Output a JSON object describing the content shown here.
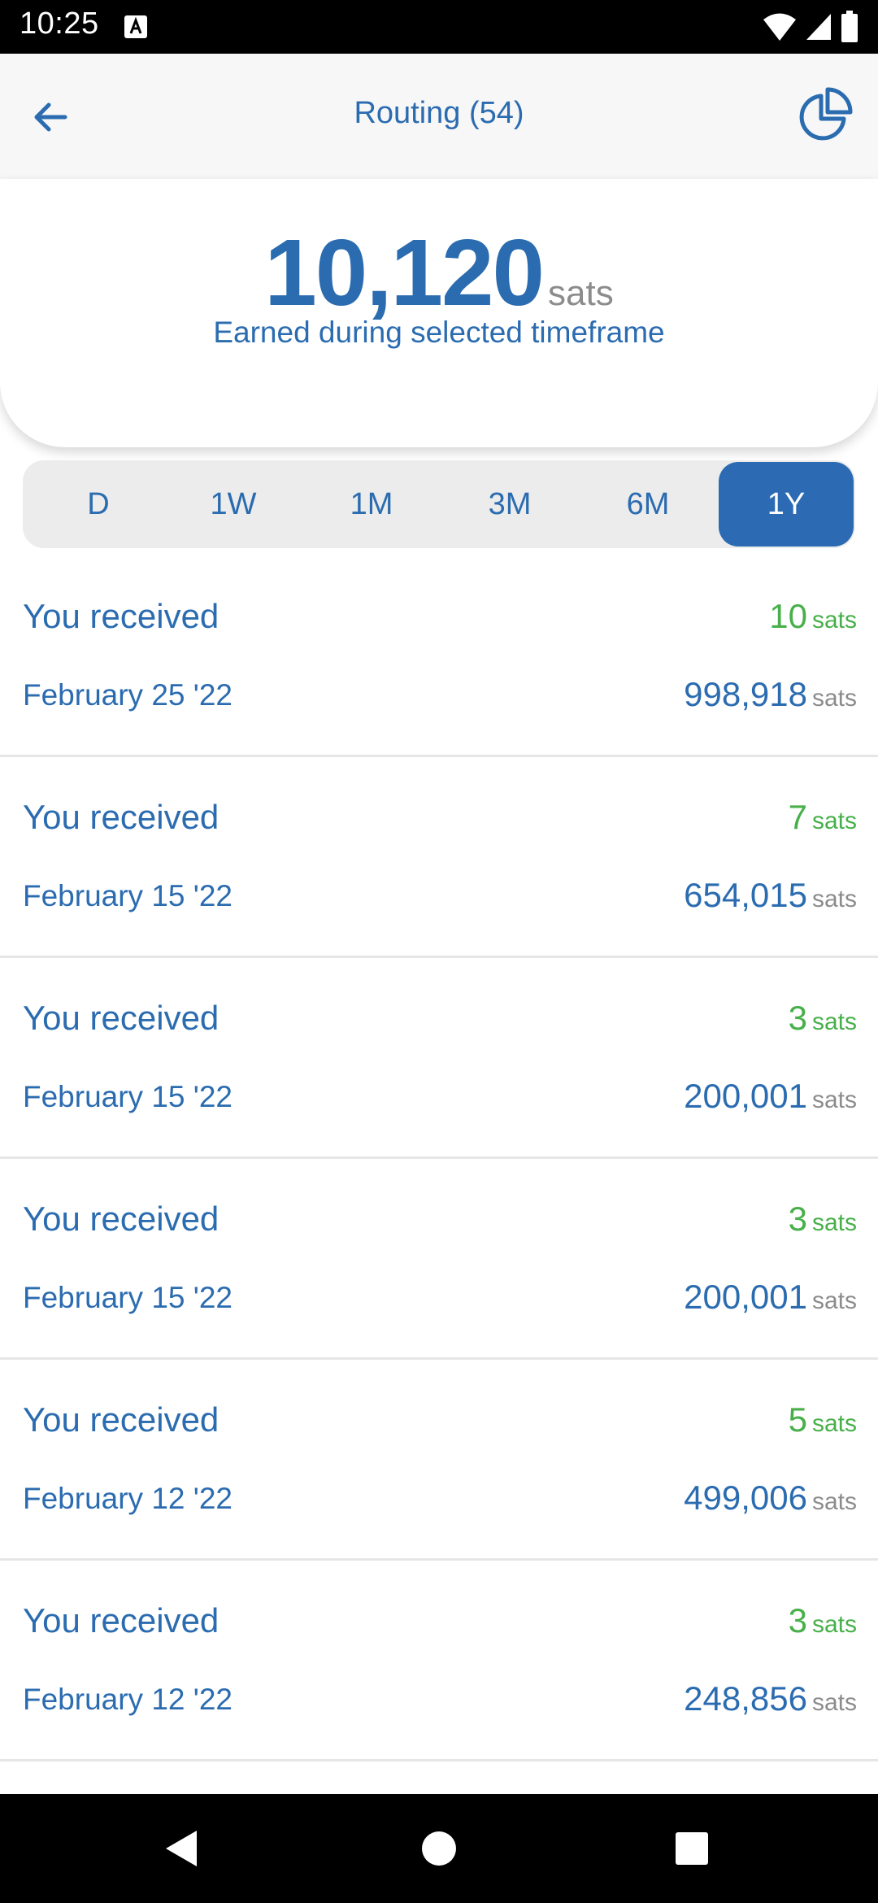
{
  "status_bar": {
    "time": "10:25",
    "icons": [
      "a-notification-icon",
      "wifi-icon",
      "cellular-signal-icon",
      "battery-icon"
    ]
  },
  "header": {
    "title": "Routing (54)",
    "back_icon": "arrow-left-icon",
    "chart_icon": "pie-chart-icon"
  },
  "summary": {
    "amount": "10,120",
    "unit": "sats",
    "caption": "Earned during selected timeframe"
  },
  "timeframes": {
    "options": [
      "D",
      "1W",
      "1M",
      "3M",
      "6M",
      "1Y"
    ],
    "selected": "1Y"
  },
  "transactions": [
    {
      "label": "You received",
      "fee": "10",
      "fee_unit": "sats",
      "date": "February 25 '22",
      "amount": "998,918",
      "amount_unit": "sats"
    },
    {
      "label": "You received",
      "fee": "7",
      "fee_unit": "sats",
      "date": "February 15 '22",
      "amount": "654,015",
      "amount_unit": "sats"
    },
    {
      "label": "You received",
      "fee": "3",
      "fee_unit": "sats",
      "date": "February 15 '22",
      "amount": "200,001",
      "amount_unit": "sats"
    },
    {
      "label": "You received",
      "fee": "3",
      "fee_unit": "sats",
      "date": "February 15 '22",
      "amount": "200,001",
      "amount_unit": "sats"
    },
    {
      "label": "You received",
      "fee": "5",
      "fee_unit": "sats",
      "date": "February 12 '22",
      "amount": "499,006",
      "amount_unit": "sats"
    },
    {
      "label": "You received",
      "fee": "3",
      "fee_unit": "sats",
      "date": "February 12 '22",
      "amount": "248,856",
      "amount_unit": "sats"
    }
  ],
  "colors": {
    "accent": "#2b6cb0",
    "positive": "#48b04a",
    "muted": "#8c8c8c",
    "selected_bg": "#2c6bb3"
  },
  "nav_bar": {
    "icons": [
      "back-triangle-icon",
      "home-circle-icon",
      "recents-square-icon"
    ]
  }
}
